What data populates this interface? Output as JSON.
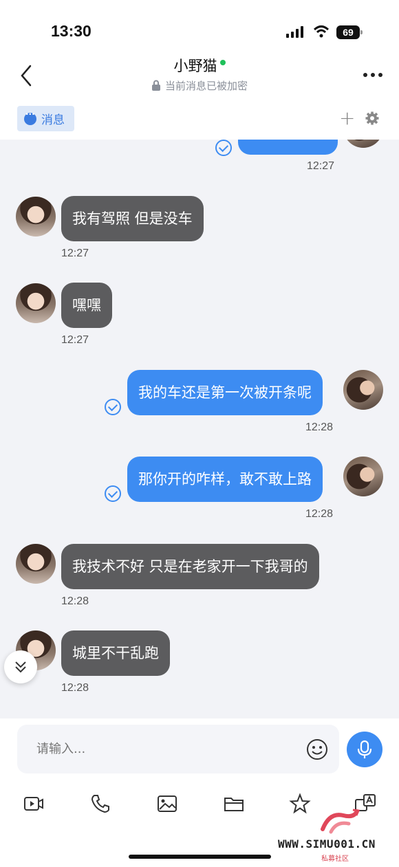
{
  "status": {
    "time": "13:30",
    "battery": "69"
  },
  "header": {
    "contact_name": "小野猫",
    "encryption_note": "当前消息已被加密"
  },
  "tabs": {
    "messages_label": "消息"
  },
  "messages": [
    {
      "side": "out",
      "text": "",
      "time": "12:27"
    },
    {
      "side": "in",
      "text": "我有驾照 但是没车",
      "time": "12:27"
    },
    {
      "side": "in",
      "text": "嘿嘿",
      "time": "12:27"
    },
    {
      "side": "out",
      "text": "我的车还是第一次被开条呢",
      "time": "12:28"
    },
    {
      "side": "out",
      "text": "那你开的咋样，敢不敢上路",
      "time": "12:28"
    },
    {
      "side": "in",
      "text": "我技术不好 只是在老家开一下我哥的",
      "time": "12:28"
    },
    {
      "side": "in",
      "text": "城里不干乱跑",
      "time": "12:28"
    }
  ],
  "input": {
    "placeholder": "请输入..."
  },
  "toolbar": [
    "video-icon",
    "phone-icon",
    "image-icon",
    "folder-icon",
    "star-icon",
    "translate-icon"
  ],
  "watermark": {
    "text": "WWW.SIMU001.CN",
    "subtext": "私募社区"
  },
  "colors": {
    "outgoing_bubble": "#3d8cf2",
    "incoming_bubble": "#5c5c5e",
    "online": "#1fc05a",
    "chat_bg": "#f2f3f7"
  }
}
